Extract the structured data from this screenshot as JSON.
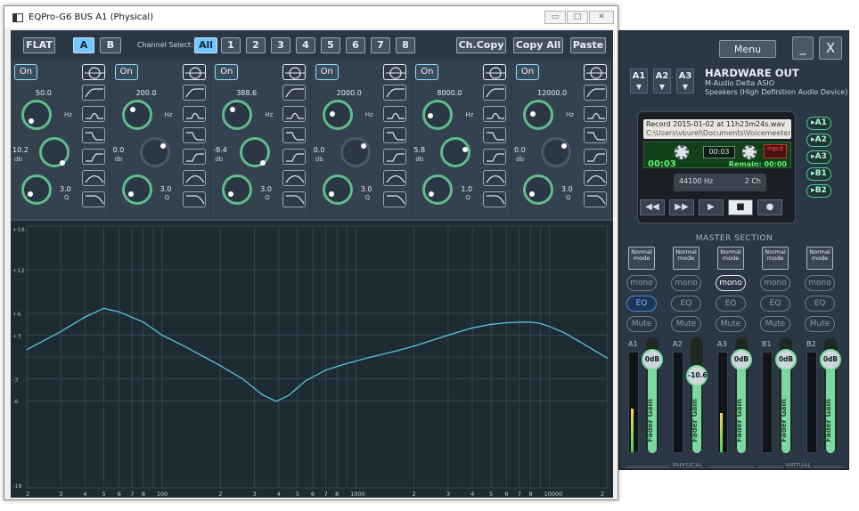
{
  "background_app": {
    "menu_label": "Menu",
    "minimize_label": "_",
    "close_label": "X",
    "hw_buses": [
      "A1",
      "A2",
      "A3"
    ],
    "hardware_out": {
      "title": "HARDWARE OUT",
      "device1": "M-Audio Delta ASIO",
      "device2": "Speakers (High Definition Audio Device)"
    },
    "recorder": {
      "filename": "Record 2015-01-02 at 11h23m24s.wav",
      "path": "C:\\Users\\vburel\\Documents\\Voicemeeter",
      "time": "00:03",
      "input_label": "input",
      "elapsed": "00:03",
      "remain": "Remain: 00:00",
      "rate": "44100 Hz",
      "channels": "2 Ch",
      "transport": [
        "◀◀",
        "▶▶",
        "▶",
        "■",
        "●"
      ]
    },
    "routing_buttons": [
      "▸A1",
      "▸A2",
      "▸A3",
      "▸B1",
      "▸B2"
    ],
    "master": {
      "title": "MASTER SECTION",
      "strips": [
        {
          "label": "A1",
          "mode": "Normal mode",
          "mono": "mono",
          "eq": "EQ",
          "mute": "Mute",
          "gain": "0dB",
          "gain_db": 0.0,
          "meter_level": 0.45
        },
        {
          "label": "A2",
          "mode": "Normal mode",
          "mono": "mono",
          "eq": "EQ",
          "mute": "Mute",
          "gain": "-10.6",
          "gain_db": -10.6,
          "meter_level": 0.0
        },
        {
          "label": "A3",
          "mode": "Normal mode",
          "mono": "mono",
          "eq": "EQ",
          "mute": "Mute",
          "gain": "0dB",
          "gain_db": 0.0,
          "meter_level": 0.4
        },
        {
          "label": "B1",
          "mode": "Normal mode",
          "mono": "mono",
          "eq": "EQ",
          "mute": "Mute",
          "gain": "0dB",
          "gain_db": 0.0,
          "meter_level": 0.0
        },
        {
          "label": "B2",
          "mode": "Normal mode",
          "mono": "mono",
          "eq": "EQ",
          "mute": "Mute",
          "gain": "0dB",
          "gain_db": 0.0,
          "meter_level": 0.0
        }
      ],
      "fader_label": "Fader Gain",
      "group_physical": "PHYSICAL",
      "group_virtual": "VIRTUAL"
    }
  },
  "eq_window": {
    "title": "EQPro-G6 BUS A1 (Physical)",
    "win_controls": [
      "▭",
      "□",
      "✕"
    ],
    "toolbar": {
      "flat": "FLAT",
      "preset_a": "A",
      "preset_b": "B",
      "channel_select_label": "Channel Select:",
      "channels": [
        "All",
        "1",
        "2",
        "3",
        "4",
        "5",
        "6",
        "7",
        "8"
      ],
      "ch_copy": "Ch.Copy",
      "copy_all": "Copy All",
      "paste": "Paste"
    },
    "on_label": "On",
    "units": {
      "freq": "Hz",
      "gain": "db",
      "q": "Q"
    },
    "bands": [
      {
        "freq": "50.0",
        "gain": "10.2",
        "q": "3.0"
      },
      {
        "freq": "200.0",
        "gain": "0.0",
        "q": "3.0"
      },
      {
        "freq": "388.6",
        "gain": "-8.4",
        "q": "3.0"
      },
      {
        "freq": "2000.0",
        "gain": "0.0",
        "q": "3.0"
      },
      {
        "freq": "8000.0",
        "gain": "5.8",
        "q": "1.0"
      },
      {
        "freq": "12000.0",
        "gain": "0.0",
        "q": "3.0"
      }
    ],
    "filter_shapes": [
      "hp",
      "peak",
      "ls",
      "hs",
      "bp",
      "lp"
    ],
    "colors": {
      "curve": "#54c7d9",
      "knob": "#5ebd8a",
      "accent": "#75c8ff"
    }
  },
  "chart_data": {
    "type": "line",
    "title": "",
    "x_scale": "log",
    "xlim": [
      20,
      20000
    ],
    "ylim": [
      -18,
      18
    ],
    "x_tick_labels": [
      "2",
      "3",
      "4",
      "5",
      "6",
      "7",
      "8",
      "100",
      "2",
      "3",
      "4",
      "5",
      "6",
      "7",
      "8",
      "1000",
      "2",
      "3",
      "4",
      "5",
      "6",
      "7",
      "8",
      "10000",
      "2"
    ],
    "y_tick_labels": [
      "+18",
      "+12",
      "+6",
      "+3",
      "-3",
      "-6",
      "-18"
    ],
    "grid": true,
    "series": [
      {
        "x": [
          20,
          30,
          40,
          50,
          60,
          80,
          100,
          130,
          160,
          200,
          260,
          330,
          388.6,
          450,
          550,
          700,
          900,
          1200,
          1600,
          2000,
          3000,
          4000,
          5000,
          6000,
          7000,
          8000,
          9000,
          10000,
          12000,
          15000,
          20000
        ],
        "values": [
          1.0,
          3.5,
          5.5,
          6.7,
          6.2,
          4.8,
          3.0,
          1.5,
          0.2,
          -1.2,
          -3.0,
          -5.2,
          -6.1,
          -5.3,
          -3.3,
          -1.8,
          -0.9,
          0.0,
          0.8,
          1.5,
          3.0,
          4.0,
          4.5,
          4.7,
          4.8,
          4.8,
          4.6,
          4.2,
          3.3,
          1.8,
          -0.2
        ]
      }
    ]
  }
}
